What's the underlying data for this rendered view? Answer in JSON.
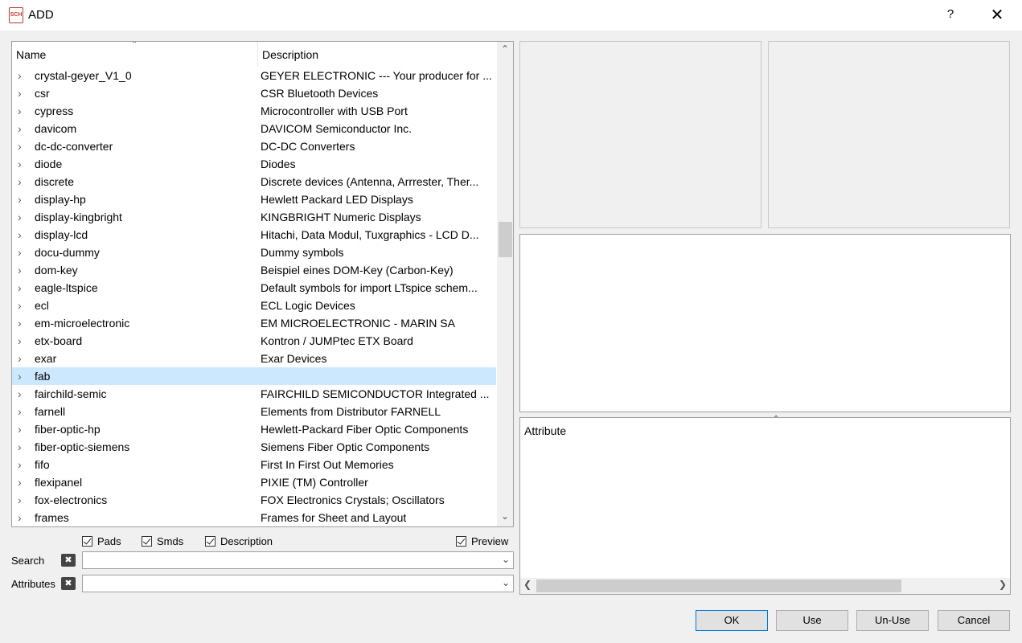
{
  "window": {
    "icon_text": "SCH",
    "title": "ADD",
    "help": "?",
    "close": "✕"
  },
  "tree": {
    "columns": {
      "name": "Name",
      "description": "Description"
    },
    "rows": [
      {
        "name": "crystal-geyer_V1_0",
        "description": "GEYER ELECTRONIC --- Your producer for ..."
      },
      {
        "name": "csr",
        "description": "CSR Bluetooth Devices"
      },
      {
        "name": "cypress",
        "description": "Microcontroller with USB Port"
      },
      {
        "name": "davicom",
        "description": "DAVICOM Semiconductor Inc."
      },
      {
        "name": "dc-dc-converter",
        "description": "DC-DC Converters"
      },
      {
        "name": "diode",
        "description": "Diodes"
      },
      {
        "name": "discrete",
        "description": "Discrete devices (Antenna, Arrrester, Ther..."
      },
      {
        "name": "display-hp",
        "description": "Hewlett Packard LED Displays"
      },
      {
        "name": "display-kingbright",
        "description": "KINGBRIGHT Numeric Displays"
      },
      {
        "name": "display-lcd",
        "description": "Hitachi, Data Modul, Tuxgraphics - LCD D..."
      },
      {
        "name": "docu-dummy",
        "description": "Dummy symbols"
      },
      {
        "name": "dom-key",
        "description": "Beispiel eines DOM-Key (Carbon-Key)"
      },
      {
        "name": "eagle-ltspice",
        "description": "Default symbols for import LTspice schem..."
      },
      {
        "name": "ecl",
        "description": "ECL Logic Devices"
      },
      {
        "name": "em-microelectronic",
        "description": "EM MICROELECTRONIC - MARIN SA"
      },
      {
        "name": "etx-board",
        "description": "Kontron / JUMPtec ETX Board"
      },
      {
        "name": "exar",
        "description": "Exar Devices"
      },
      {
        "name": "fab",
        "description": "",
        "selected": true
      },
      {
        "name": "fairchild-semic",
        "description": "FAIRCHILD SEMICONDUCTOR Integrated ..."
      },
      {
        "name": "farnell",
        "description": "Elements from Distributor FARNELL"
      },
      {
        "name": "fiber-optic-hp",
        "description": "Hewlett-Packard Fiber Optic Components"
      },
      {
        "name": "fiber-optic-siemens",
        "description": "Siemens Fiber Optic Components"
      },
      {
        "name": "fifo",
        "description": "First In First Out Memories"
      },
      {
        "name": "flexipanel",
        "description": "PIXIE (TM) Controller"
      },
      {
        "name": "fox-electronics",
        "description": "FOX Electronics Crystals; Oscillators"
      },
      {
        "name": "frames",
        "description": "Frames for Sheet and Layout"
      }
    ]
  },
  "options": {
    "pads": "Pads",
    "smds": "Smds",
    "description": "Description",
    "preview": "Preview"
  },
  "search": {
    "label": "Search",
    "value": ""
  },
  "attributes_filter": {
    "label": "Attributes",
    "value": ""
  },
  "attribute_panel": {
    "header": "Attribute"
  },
  "buttons": {
    "ok": "OK",
    "use": "Use",
    "unuse": "Un-Use",
    "cancel": "Cancel"
  }
}
